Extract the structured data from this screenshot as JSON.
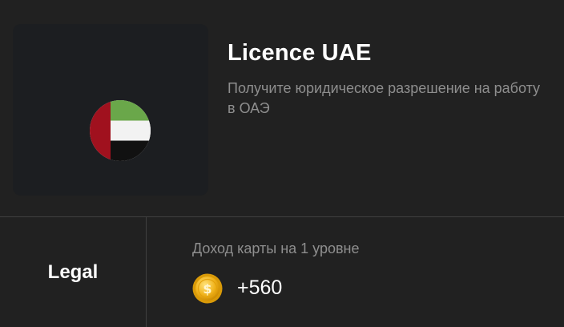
{
  "card": {
    "title": "Licence UAE",
    "description": "Получите юридическое разрешение на работу в ОАЭ",
    "flag_icon": "uae-flag-icon",
    "flag_colors": {
      "red": "#a0111e",
      "green": "#6aa74a",
      "white": "#f2f2f2",
      "black": "#111111"
    }
  },
  "footer": {
    "category": "Legal",
    "income_label": "Доход карты на 1 уровне",
    "coin_icon": "gold-coin-icon",
    "income_value": "+560"
  },
  "colors": {
    "background": "#212121",
    "image_box": "#1c1e21",
    "muted_text": "#8e8e8e",
    "divider": "#3f3f3f",
    "coin": "#f0b21a"
  }
}
